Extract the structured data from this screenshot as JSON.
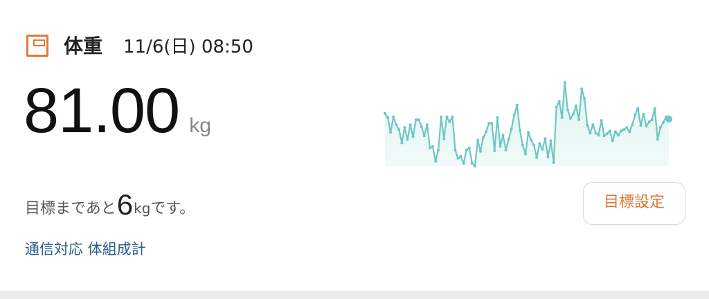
{
  "header": {
    "icon": "scale-icon",
    "title": "体重",
    "datetime": "11/6(日) 08:50"
  },
  "weight": {
    "value": "81.00",
    "unit": "kg"
  },
  "goal": {
    "prefix": "目標まであと",
    "remaining": "6",
    "unit": "kg",
    "suffix": "です。",
    "button_label": "目標設定"
  },
  "device_link": "通信対応 体組成計",
  "colors": {
    "accent": "#e07b39",
    "line": "#6dc7c2",
    "fill": "#dff3f2",
    "link": "#2b5c8a"
  },
  "chart_data": {
    "type": "area",
    "title": "",
    "xlabel": "",
    "ylabel": "",
    "ylim": [
      81,
      94
    ],
    "grid": false,
    "series": [
      {
        "values": [
          88.5,
          87.9,
          85.8,
          88.0,
          86.9,
          86.2,
          84.3,
          86.5,
          84.8,
          86.9,
          85.2,
          87.6,
          87.6,
          86.6,
          85.3,
          86.9,
          83.6,
          83.8,
          81.7,
          83.3,
          88.0,
          84.9,
          88.0,
          87.3,
          88.0,
          83.3,
          82.1,
          82.4,
          81.4,
          83.3,
          83.6,
          81.4,
          81.0,
          84.7,
          83.1,
          85.1,
          85.9,
          87.1,
          87.1,
          83.2,
          87.9,
          83.8,
          85.4,
          83.3,
          84.8,
          86.3,
          88.3,
          89.7,
          86.1,
          84.0,
          82.7,
          85.8,
          84.7,
          84.0,
          82.2,
          84.2,
          83.4,
          84.9,
          82.3,
          84.6,
          81.5,
          89.4,
          90.2,
          87.9,
          92.9,
          89.0,
          87.8,
          88.4,
          89.6,
          87.6,
          92.0,
          90.6,
          86.8,
          85.7,
          86.9,
          85.7,
          85.4,
          87.5,
          85.3,
          85.6,
          86.0,
          84.6,
          85.9,
          85.4,
          86.0,
          86.2,
          86.5,
          85.9,
          86.9,
          88.3,
          89.2,
          86.8,
          88.4,
          86.7,
          87.3,
          87.6,
          89.2,
          84.8,
          86.5,
          87.2,
          88.0,
          87.7
        ]
      }
    ]
  }
}
